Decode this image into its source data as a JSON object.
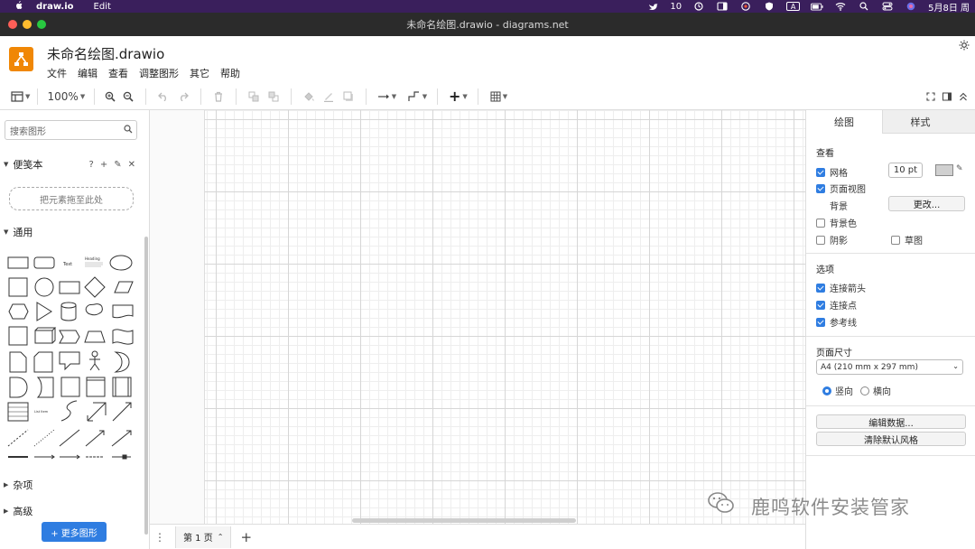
{
  "menubar": {
    "app": "draw.io",
    "menu": "Edit",
    "notif_count": "10",
    "ime": "A",
    "date": "5月8日 周"
  },
  "window": {
    "title": "未命名绘图.drawio - diagrams.net"
  },
  "header": {
    "doc_title": "未命名绘图.drawio",
    "menus": [
      "文件",
      "编辑",
      "查看",
      "调整图形",
      "其它",
      "帮助"
    ]
  },
  "toolbar": {
    "zoom": "100%"
  },
  "left": {
    "search_placeholder": "搜索图形",
    "scratchpad_title": "便笺本",
    "scratchpad_icons": [
      "?",
      "+",
      "✎",
      "✕"
    ],
    "dropzone": "把元素拖至此处",
    "general_title": "通用",
    "shape_texts": {
      "text": "Text",
      "heading": "Heading",
      "list": "List Item"
    },
    "misc_title": "杂项",
    "advanced_title": "高级",
    "more_shapes": "+ 更多图形"
  },
  "bottom": {
    "page_tab": "第 1 页"
  },
  "right": {
    "tabs": [
      "绘图",
      "样式"
    ],
    "view_title": "查看",
    "grid": "网格",
    "grid_size": "10 pt",
    "page_view": "页面视图",
    "background": "背景",
    "change": "更改...",
    "bg_color": "背景色",
    "shadow": "阴影",
    "sketch": "草图",
    "options_title": "选项",
    "connection_arrows": "连接箭头",
    "connection_points": "连接点",
    "guides": "参考线",
    "page_size_title": "页面尺寸",
    "page_size": "A4 (210 mm x 297 mm)",
    "portrait": "竖向",
    "landscape": "横向",
    "edit_data": "编辑数据...",
    "clear_style": "清除默认风格"
  },
  "watermark": {
    "text": "鹿鸣软件安装管家"
  }
}
